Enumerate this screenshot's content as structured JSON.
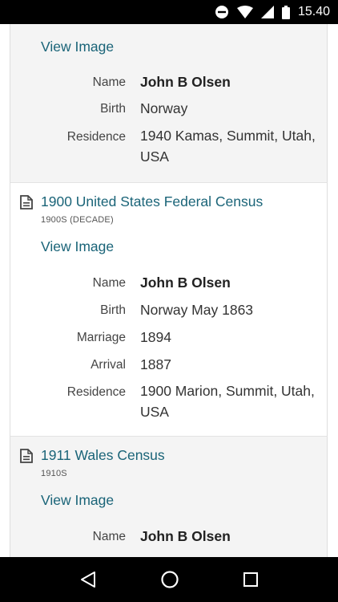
{
  "status_bar": {
    "time": "15.40"
  },
  "records": [
    {
      "view_image_label": "View Image",
      "fields": [
        {
          "label": "Name",
          "value": "John B Olsen"
        },
        {
          "label": "Birth",
          "value": "Norway"
        },
        {
          "label": "Residence",
          "value": "1940 Kamas, Summit, Utah, USA"
        }
      ]
    },
    {
      "title": "1900 United States Federal Census",
      "subtitle": "1900S (DECADE)",
      "view_image_label": "View Image",
      "fields": [
        {
          "label": "Name",
          "value": "John B Olsen"
        },
        {
          "label": "Birth",
          "value": "Norway May 1863"
        },
        {
          "label": "Marriage",
          "value": "1894"
        },
        {
          "label": "Arrival",
          "value": "1887"
        },
        {
          "label": "Residence",
          "value": "1900 Marion, Summit, Utah, USA"
        }
      ]
    },
    {
      "title": "1911 Wales Census",
      "subtitle": "1910S",
      "view_image_label": "View Image",
      "fields": [
        {
          "label": "Name",
          "value": "John B Olsen"
        }
      ]
    }
  ]
}
